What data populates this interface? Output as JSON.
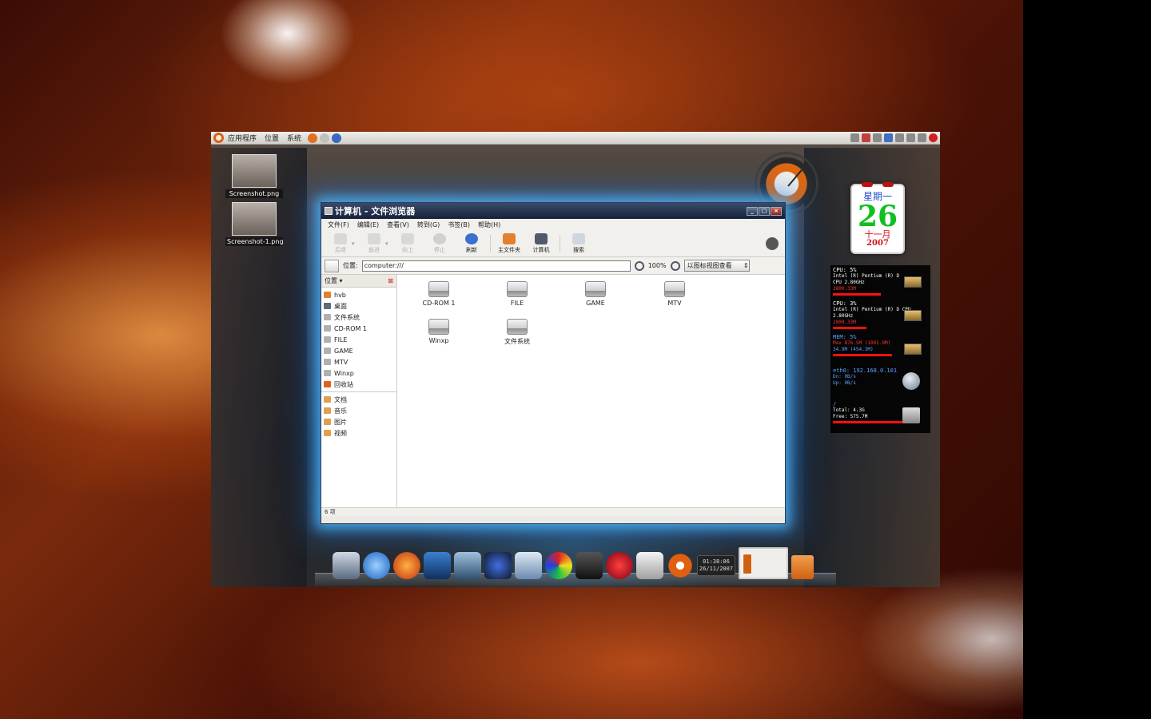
{
  "top_panel": {
    "menu": [
      "应用程序",
      "位置",
      "系统"
    ]
  },
  "desktop_icons": [
    {
      "label": "Screenshot.png"
    },
    {
      "label": "Screenshot-1.png"
    }
  ],
  "calendar": {
    "weekday": "星期一",
    "day": "26",
    "month": "十一月",
    "year": "2007"
  },
  "sysmon": {
    "cpu0": {
      "head": "CPU: 5%",
      "model": "Intel (R) Pentium (R) D",
      "freq": "CPU 2.80GHz",
      "extra": "2800.33M"
    },
    "cpu1": {
      "head": "CPU: 3%",
      "model": "Intel (R) Pentium (R) D CPU",
      "freq": "2.80GHz",
      "extra": "2800.33M"
    },
    "mem": {
      "head": "MEM: 5%",
      "max": "Max 876.5M (1001.9M)",
      "used": "34.9M (454.3M)"
    },
    "net": {
      "head": "eth0: 192.168.0.101",
      "down": "Dn: 0B/s",
      "up": "Up: 0B/s"
    },
    "disk": {
      "head": "/",
      "total": "Total: 4.3G",
      "free": "Free: 575.7M"
    }
  },
  "window": {
    "title": "计算机 - 文件浏览器",
    "menubar": [
      "文件(F)",
      "编辑(E)",
      "查看(V)",
      "转到(G)",
      "书签(B)",
      "帮助(H)"
    ],
    "toolbar": {
      "back": "后退",
      "forward": "前进",
      "up": "向上",
      "stop": "停止",
      "reload": "刷新",
      "home": "主文件夹",
      "computer": "计算机",
      "search": "搜索"
    },
    "location": {
      "label": "位置:",
      "value": "computer:///",
      "zoom": "100%",
      "view_mode": "以图标视图查看"
    },
    "sidebar": {
      "header": "位置",
      "places": [
        "hvb",
        "桌面",
        "文件系统",
        "CD-ROM 1",
        "FILE",
        "GAME",
        "MTV",
        "Winxp",
        "回收站"
      ],
      "bookmarks": [
        "文档",
        "音乐",
        "图片",
        "视频"
      ]
    },
    "files": [
      "CD-ROM 1",
      "FILE",
      "GAME",
      "MTV",
      "Winxp",
      "文件系统"
    ],
    "status": "6 项"
  },
  "dock": {
    "clock_time": "01:38:06",
    "clock_date": "26/11/2007"
  }
}
